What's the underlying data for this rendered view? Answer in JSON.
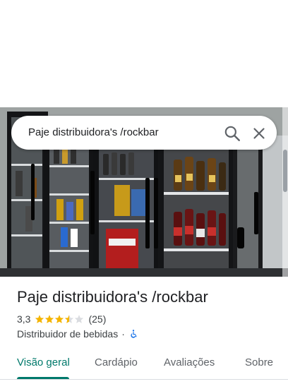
{
  "search": {
    "query": "Paje distribuidora's /rockbar"
  },
  "place": {
    "title": "Paje distribuidora's /rockbar",
    "rating": "3,3",
    "stars": 3.3,
    "review_count": "(25)",
    "category": "Distribuidor de bebidas",
    "separator": "·"
  },
  "tabs": [
    {
      "label": "Visão geral",
      "active": true
    },
    {
      "label": "Cardápio",
      "active": false
    },
    {
      "label": "Avaliações",
      "active": false
    },
    {
      "label": "Sobre",
      "active": false
    }
  ],
  "colors": {
    "accent": "#00796b",
    "star": "#f4b400",
    "star_empty": "#dadce0",
    "accessibility": "#1a73e8"
  },
  "icons": {
    "search": "search-icon",
    "close": "close-icon",
    "accessibility": "wheelchair-icon"
  }
}
